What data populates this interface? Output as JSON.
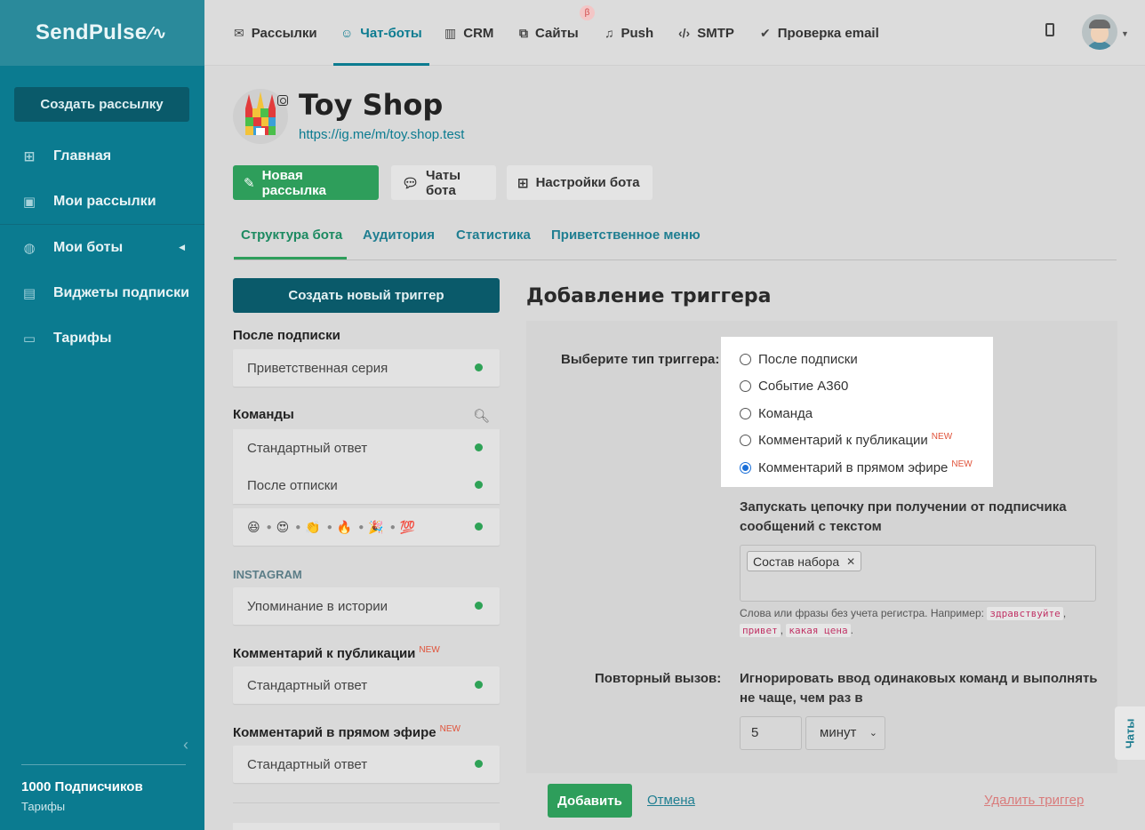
{
  "sidebar": {
    "brand": "SendPulse",
    "create_button": "Создать рассылку",
    "items": [
      {
        "label": "Главная",
        "icon": "dashboard-icon"
      },
      {
        "label": "Мои рассылки",
        "icon": "inbox-icon"
      },
      {
        "label": "Мои боты",
        "icon": "globe-icon"
      },
      {
        "label": "Виджеты подписки",
        "icon": "widget-icon"
      },
      {
        "label": "Тарифы",
        "icon": "wallet-icon"
      }
    ],
    "subscribers": "1000 Подписчиков",
    "tariffs_link": "Тарифы"
  },
  "topnav": {
    "items": [
      {
        "label": "Рассылки",
        "icon": "mail-icon"
      },
      {
        "label": "Чат-боты",
        "icon": "chat-bot-icon",
        "active": true
      },
      {
        "label": "CRM",
        "icon": "crm-icon"
      },
      {
        "label": "Сайты",
        "icon": "site-icon"
      },
      {
        "label": "Push",
        "icon": "bell-icon"
      },
      {
        "label": "SMTP",
        "icon": "code-icon"
      },
      {
        "label": "Проверка email",
        "icon": "check-icon"
      }
    ],
    "beta_badge": "β"
  },
  "bot": {
    "name": "Toy Shop",
    "link": "https://ig.me/m/toy.shop.test"
  },
  "actions": {
    "new_mailing": "Новая рассылка",
    "bot_chats": "Чаты бота",
    "bot_settings": "Настройки бота"
  },
  "tabs": [
    "Структура бота",
    "Аудитория",
    "Статистика",
    "Приветственное меню"
  ],
  "left": {
    "create_trigger": "Создать новый триггер",
    "groups": {
      "after_subscribe": {
        "title": "После подписки",
        "items": [
          "Приветственная серия"
        ]
      },
      "commands": {
        "title": "Команды",
        "items": [
          "Стандартный ответ",
          "После отписки"
        ]
      },
      "instagram_caption": "INSTAGRAM",
      "instagram": {
        "items": [
          "Упоминание в истории"
        ]
      },
      "post_comment": {
        "title": "Комментарий к публикации",
        "badge": "NEW",
        "items": [
          "Стандартный ответ"
        ]
      },
      "live_comment": {
        "title": "Комментарий в прямом эфире",
        "badge": "NEW",
        "items": [
          "Стандартный ответ"
        ]
      }
    },
    "emojis": [
      "😆",
      "😍",
      "👏",
      "🔥",
      "🎉",
      "💯"
    ],
    "status_color": "#2ea256"
  },
  "form": {
    "title": "Добавление триггера",
    "trigger_type_label": "Выберите тип триггера:",
    "options": [
      {
        "label": "После подписки",
        "new": ""
      },
      {
        "label": "Событие A360",
        "new": ""
      },
      {
        "label": "Команда",
        "new": ""
      },
      {
        "label": "Комментарий к публикации",
        "new": "NEW"
      },
      {
        "label": "Комментарий в прямом эфире",
        "new": "NEW"
      }
    ],
    "selected_option": "Комментарий в прямом эфире",
    "run_chain_line1": "Запускать цепочку при получении от подписчика",
    "run_chain_line2": "сообщений с текстом",
    "tag": "Состав набора",
    "hint_prefix": "Слова или фразы без учета регистра. Например:",
    "hint_examples": [
      "здравствуйте",
      "привет",
      "какая цена"
    ],
    "repeat_label": "Повторный вызов:",
    "repeat_line1": "Игнорировать ввод одинаковых команд и выполнять",
    "repeat_line2": "не чаще, чем раз в",
    "repeat_value": "5",
    "repeat_unit": "минут",
    "add_button": "Добавить",
    "cancel_link": "Отмена",
    "delete_link": "Удалить триггер"
  },
  "chats_tab": "Чаты"
}
